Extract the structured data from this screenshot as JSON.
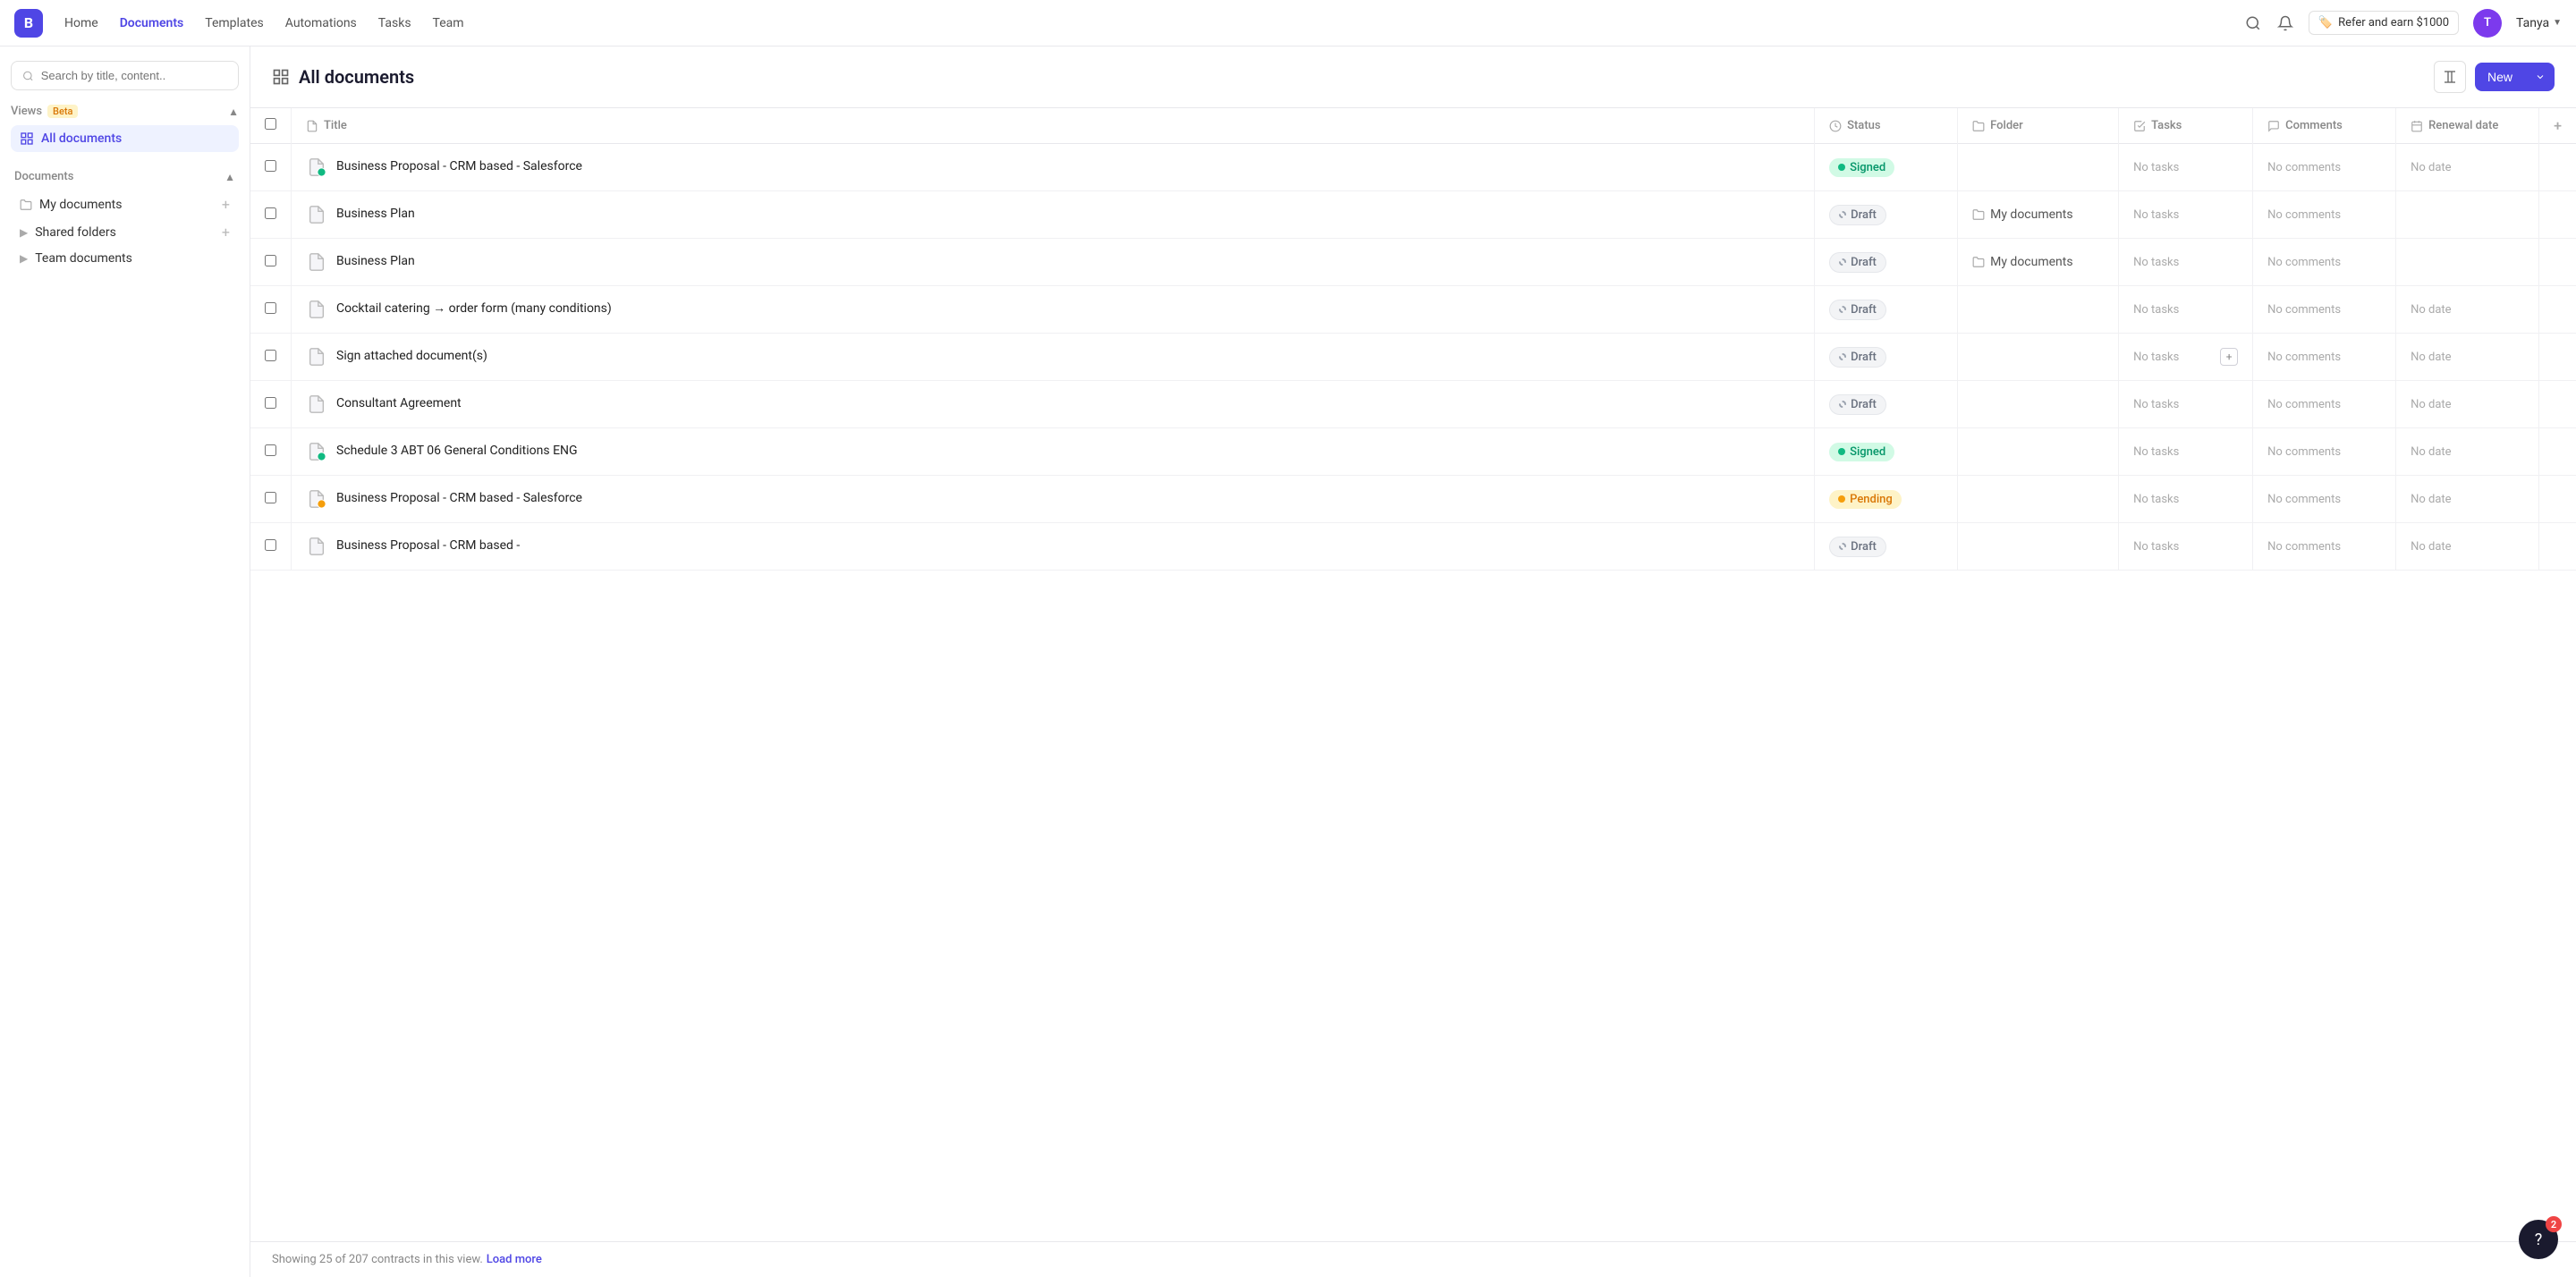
{
  "topnav": {
    "logo_text": "B",
    "links": [
      {
        "label": "Home",
        "active": false
      },
      {
        "label": "Documents",
        "active": true
      },
      {
        "label": "Templates",
        "active": false
      },
      {
        "label": "Automations",
        "active": false
      },
      {
        "label": "Tasks",
        "active": false
      },
      {
        "label": "Team",
        "active": false
      }
    ],
    "refer_label": "Refer and earn $1000",
    "user_name": "Tanya",
    "user_initials": "T"
  },
  "sidebar": {
    "search_placeholder": "Search by title, content..",
    "views_label": "Views",
    "beta_label": "Beta",
    "all_documents_label": "All documents",
    "documents_section_label": "Documents",
    "my_documents_label": "My documents",
    "shared_folders_label": "Shared folders",
    "team_documents_label": "Team documents"
  },
  "header": {
    "title": "All documents",
    "new_label": "New"
  },
  "table": {
    "columns": [
      {
        "label": "Title",
        "icon": "title-icon"
      },
      {
        "label": "Status",
        "icon": "status-icon"
      },
      {
        "label": "Folder",
        "icon": "folder-icon"
      },
      {
        "label": "Tasks",
        "icon": "tasks-icon"
      },
      {
        "label": "Comments",
        "icon": "comments-icon"
      },
      {
        "label": "Renewal date",
        "icon": "calendar-icon"
      }
    ],
    "rows": [
      {
        "title": "Business Proposal - CRM based - Salesforce",
        "status": "Signed",
        "status_type": "signed",
        "folder": "",
        "tasks": "No tasks",
        "comments": "No comments",
        "renewal_date": "No date",
        "doc_icon_type": "signed"
      },
      {
        "title": "Business Plan",
        "status": "Draft",
        "status_type": "draft",
        "folder": "My documents",
        "tasks": "No tasks",
        "comments": "No comments",
        "renewal_date": "",
        "doc_icon_type": "normal"
      },
      {
        "title": "Business Plan",
        "status": "Draft",
        "status_type": "draft",
        "folder": "My documents",
        "tasks": "No tasks",
        "comments": "No comments",
        "renewal_date": "",
        "doc_icon_type": "normal"
      },
      {
        "title": "Cocktail catering → order form (many conditions)",
        "status": "Draft",
        "status_type": "draft",
        "folder": "",
        "tasks": "No tasks",
        "comments": "No comments",
        "renewal_date": "No date",
        "doc_icon_type": "normal"
      },
      {
        "title": "Sign attached document(s)",
        "status": "Draft",
        "status_type": "draft",
        "folder": "",
        "tasks": "No tasks",
        "comments": "No comments",
        "renewal_date": "No date",
        "doc_icon_type": "normal",
        "show_add_task": true
      },
      {
        "title": "Consultant Agreement",
        "status": "Draft",
        "status_type": "draft",
        "folder": "",
        "tasks": "No tasks",
        "comments": "No comments",
        "renewal_date": "No date",
        "doc_icon_type": "normal"
      },
      {
        "title": "Schedule 3 ABT 06 General Conditions ENG",
        "status": "Signed",
        "status_type": "signed",
        "folder": "",
        "tasks": "No tasks",
        "comments": "No comments",
        "renewal_date": "No date",
        "doc_icon_type": "signed"
      },
      {
        "title": "Business Proposal - CRM based - Salesforce",
        "status": "Pending",
        "status_type": "pending",
        "folder": "",
        "tasks": "No tasks",
        "comments": "No comments",
        "renewal_date": "No date",
        "doc_icon_type": "pending"
      },
      {
        "title": "Business Proposal - CRM based -",
        "status": "Draft",
        "status_type": "draft",
        "folder": "",
        "tasks": "No tasks",
        "comments": "No comments",
        "renewal_date": "No date",
        "doc_icon_type": "normal"
      }
    ]
  },
  "footer": {
    "showing_text": "Showing 25 of 207 contracts in this view.",
    "load_more_label": "Load more"
  },
  "help": {
    "badge_count": "2",
    "icon": "?"
  }
}
